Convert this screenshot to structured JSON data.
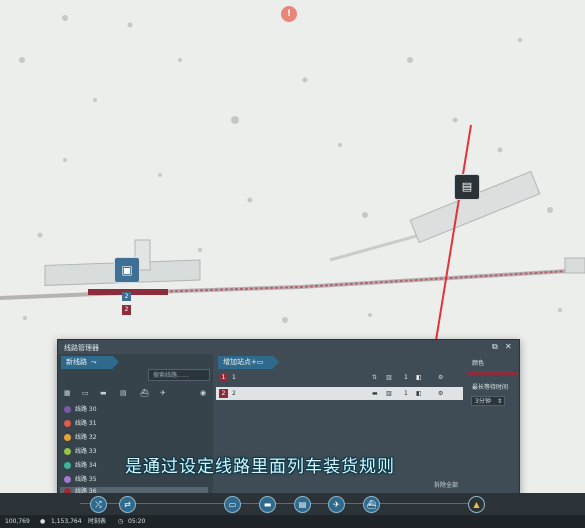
{
  "map": {
    "marker_exclaim": "!",
    "station_marker_1": "2",
    "station_marker_2": "2"
  },
  "panel": {
    "title": "线路管理器",
    "new_line_label": "新线路",
    "search_placeholder": "搜索线路……",
    "add_stop_label": "增加站点",
    "lines": [
      {
        "label": "线路 30",
        "color": "#7b59a8"
      },
      {
        "label": "线路 31",
        "color": "#e05a4d"
      },
      {
        "label": "线路 32",
        "color": "#e8a23a"
      },
      {
        "label": "线路 33",
        "color": "#9bc24a"
      },
      {
        "label": "线路 34",
        "color": "#3fb49a"
      },
      {
        "label": "线路 35",
        "color": "#a07ad0"
      },
      {
        "label": "线路 36",
        "color": "#9b2a3a"
      }
    ],
    "stops": [
      {
        "num": "1",
        "name": "1",
        "qty": "1"
      },
      {
        "num": "2",
        "name": "2",
        "qty": "1"
      }
    ],
    "right": {
      "color_label": "颜色",
      "max_wait_label": "最长等待时间",
      "wait_value": "3分钟"
    },
    "footer_label": "拆除全部"
  },
  "subtitle": "是通过设定线路里面列车装货规则",
  "status": {
    "population": "100,769",
    "money": "1,153,764",
    "speed_label": "时刻表",
    "time": "05:20"
  },
  "colors": {
    "accent": "#2f6a8c",
    "line_red": "#8d2c3a",
    "panel_bg": "#3f4c55"
  }
}
